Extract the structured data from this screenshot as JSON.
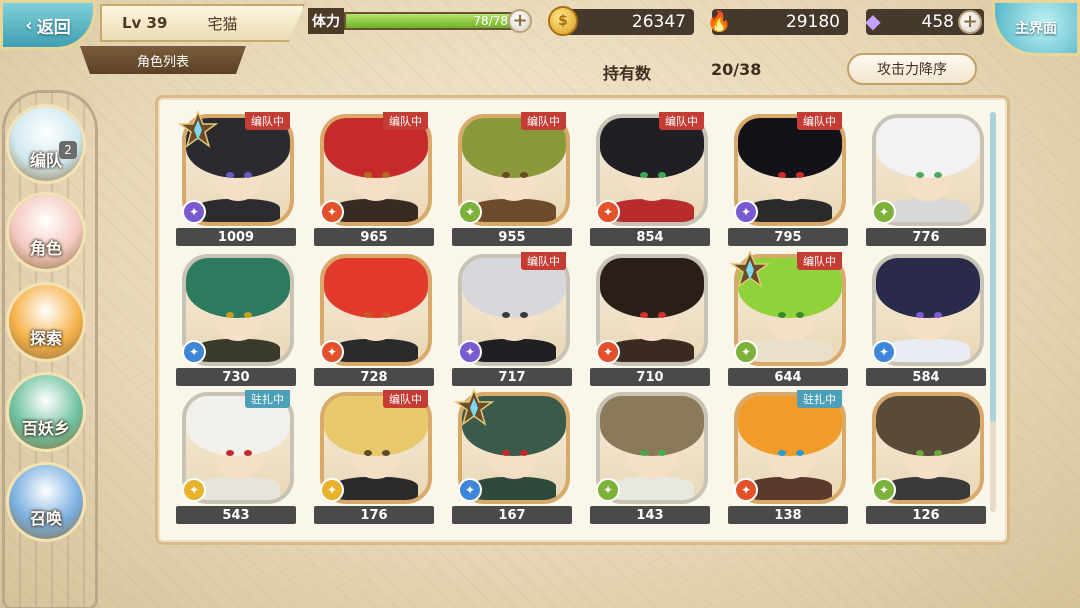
{
  "header": {
    "back_label": "返回",
    "level": "Lv 39",
    "player_name": "宅猫",
    "list_tab": "角色列表",
    "stamina_label": "体力",
    "stamina_value": "78/78",
    "stamina_fraction": 1.0,
    "coins": "26347",
    "flames": "29180",
    "gems": "458",
    "main_label": "主界面"
  },
  "toolbar": {
    "hold_label": "持有数",
    "hold_value": "20/38",
    "sort_label": "攻击力降序"
  },
  "sidebar": {
    "items": [
      {
        "label": "编队",
        "badge": "2",
        "color": "#cfe8ef",
        "icon": "team-icon"
      },
      {
        "label": "角色",
        "color": "#f4c9c0",
        "icon": "character-icon"
      },
      {
        "label": "探索",
        "color": "#f6b24a",
        "icon": "explore-icon"
      },
      {
        "label": "百妖乡",
        "color": "#6ec2a0",
        "icon": "village-icon"
      },
      {
        "label": "召唤",
        "color": "#7bb0e0",
        "icon": "summon-icon"
      }
    ]
  },
  "colors": {
    "team_tag": "#c53c35",
    "station_tag": "#4b9fb8",
    "element_purple": "#7a5ad1",
    "element_fire": "#e2512a",
    "element_wind": "#7cb23a",
    "element_water": "#3e86d6",
    "element_light": "#e8b32a"
  },
  "characters": [
    {
      "power": "1009",
      "tag": "编队中",
      "tag_type": "team",
      "element": "purple",
      "star": true,
      "hair": "#2a2a2f",
      "eye": "#6a5ac9",
      "cloth": "#2b2b30",
      "frame": "gold"
    },
    {
      "power": "965",
      "tag": "编队中",
      "tag_type": "team",
      "element": "fire",
      "star": false,
      "hair": "#c72a2a",
      "eye": "#b36a1e",
      "cloth": "#3a2a24",
      "frame": "gold"
    },
    {
      "power": "955",
      "tag": "编队中",
      "tag_type": "team",
      "element": "wind",
      "star": false,
      "hair": "#8a9a3a",
      "eye": "#6a4a20",
      "cloth": "#6d4a2a",
      "frame": "gold"
    },
    {
      "power": "854",
      "tag": "编队中",
      "tag_type": "team",
      "element": "fire",
      "star": false,
      "hair": "#1f1f24",
      "eye": "#3aa85a",
      "cloth": "#b82c2c",
      "frame": "silver"
    },
    {
      "power": "795",
      "tag": "编队中",
      "tag_type": "team",
      "element": "purple",
      "star": false,
      "hair": "#121218",
      "eye": "#d12a2a",
      "cloth": "#2a2a2a",
      "frame": "gold"
    },
    {
      "power": "776",
      "tag": "",
      "tag_type": "",
      "element": "wind",
      "star": false,
      "hair": "#f2f2f2",
      "eye": "#4aa860",
      "cloth": "#d8d8d8",
      "frame": "silver"
    },
    {
      "power": "730",
      "tag": "",
      "tag_type": "",
      "element": "water",
      "star": false,
      "hair": "#2e7a5e",
      "eye": "#c6a020",
      "cloth": "#3a3a2a",
      "frame": "silver"
    },
    {
      "power": "728",
      "tag": "",
      "tag_type": "",
      "element": "fire",
      "star": false,
      "hair": "#e23a2a",
      "eye": "#c25a22",
      "cloth": "#2a2a2a",
      "frame": "gold"
    },
    {
      "power": "717",
      "tag": "编队中",
      "tag_type": "team",
      "element": "purple",
      "star": false,
      "hair": "#d8d8dc",
      "eye": "#3a3a3a",
      "cloth": "#1f1f24",
      "frame": "silver"
    },
    {
      "power": "710",
      "tag": "",
      "tag_type": "",
      "element": "fire",
      "star": false,
      "hair": "#2a1e18",
      "eye": "#d23030",
      "cloth": "#3a2a20",
      "frame": "silver"
    },
    {
      "power": "644",
      "tag": "编队中",
      "tag_type": "team",
      "element": "wind",
      "star": true,
      "hair": "#8fd23a",
      "eye": "#3a8a2a",
      "cloth": "#e8e0c8",
      "frame": "gold"
    },
    {
      "power": "584",
      "tag": "",
      "tag_type": "",
      "element": "water",
      "star": false,
      "hair": "#2a2a4a",
      "eye": "#7a5ad1",
      "cloth": "#e8ecf4",
      "frame": "silver"
    },
    {
      "power": "543",
      "tag": "驻扎中",
      "tag_type": "station",
      "element": "light",
      "star": false,
      "hair": "#f2f0ea",
      "eye": "#c22a2a",
      "cloth": "#e8e4dc",
      "frame": "silver"
    },
    {
      "power": "176",
      "tag": "编队中",
      "tag_type": "team",
      "element": "light",
      "star": false,
      "hair": "#e8c86a",
      "eye": "#5a4a2a",
      "cloth": "#2a2a2a",
      "frame": "gold"
    },
    {
      "power": "167",
      "tag": "",
      "tag_type": "",
      "element": "water",
      "star": true,
      "hair": "#3a5a4a",
      "eye": "#c22a2a",
      "cloth": "#2e4a3a",
      "frame": "gold"
    },
    {
      "power": "143",
      "tag": "",
      "tag_type": "",
      "element": "wind",
      "star": false,
      "hair": "#8a7a5a",
      "eye": "#4aa850",
      "cloth": "#e8e8e0",
      "frame": "silver"
    },
    {
      "power": "138",
      "tag": "驻扎中",
      "tag_type": "station",
      "element": "fire",
      "star": false,
      "hair": "#f29a2a",
      "eye": "#2a9ad2",
      "cloth": "#5a3a2a",
      "frame": "gold"
    },
    {
      "power": "126",
      "tag": "",
      "tag_type": "",
      "element": "wind",
      "star": false,
      "hair": "#5a4a3a",
      "eye": "#6aaa3a",
      "cloth": "#3a3a3a",
      "frame": "gold"
    }
  ]
}
